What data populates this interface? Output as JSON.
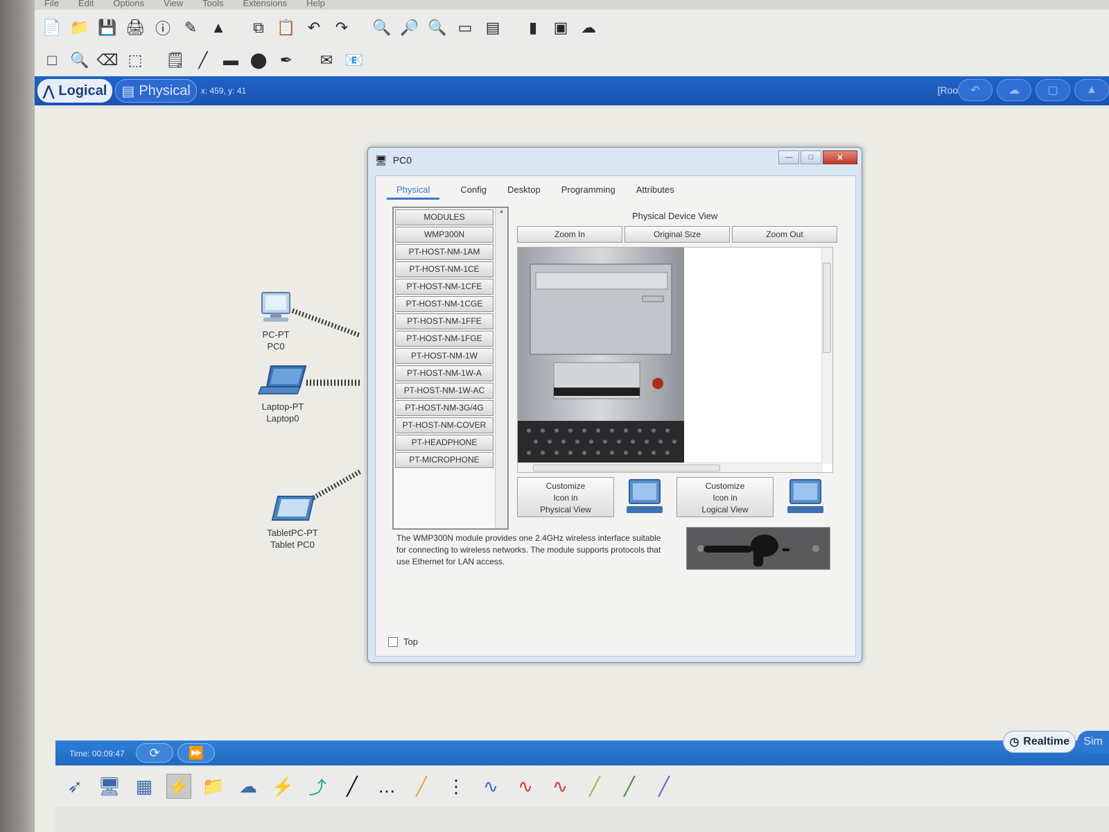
{
  "menu": [
    "File",
    "Edit",
    "Options",
    "View",
    "Tools",
    "Extensions",
    "Help"
  ],
  "modebar": {
    "logical_label": "Logical",
    "physical_label": "Physical",
    "coords": "x: 459, y: 41",
    "root_label": "[Root]"
  },
  "devices": [
    {
      "type": "PC-PT",
      "name": "PC0"
    },
    {
      "type": "Laptop-PT",
      "name": "Laptop0"
    },
    {
      "type": "TabletPC-PT",
      "name": "Tablet PC0"
    }
  ],
  "dialog": {
    "title": "PC0",
    "tabs": [
      "Physical",
      "Config",
      "Desktop",
      "Programming",
      "Attributes"
    ],
    "active_tab": "Physical",
    "modules_header": "MODULES",
    "modules": [
      "WMP300N",
      "PT-HOST-NM-1AM",
      "PT-HOST-NM-1CE",
      "PT-HOST-NM-1CFE",
      "PT-HOST-NM-1CGE",
      "PT-HOST-NM-1FFE",
      "PT-HOST-NM-1FGE",
      "PT-HOST-NM-1W",
      "PT-HOST-NM-1W-A",
      "PT-HOST-NM-1W-AC",
      "PT-HOST-NM-3G/4G",
      "PT-HOST-NM-COVER",
      "PT-HEADPHONE",
      "PT-MICROPHONE"
    ],
    "physical_device_view_label": "Physical Device View",
    "zoom_in": "Zoom In",
    "original_size": "Original Size",
    "zoom_out": "Zoom Out",
    "customize_physical": [
      "Customize",
      "Icon in",
      "Physical View"
    ],
    "customize_logical": [
      "Customize",
      "Icon in",
      "Logical View"
    ],
    "description": "The WMP300N module provides one 2.4GHz wireless interface suitable for connecting to wireless networks. The module supports protocols that use Ethernet for LAN access.",
    "top_checkbox": "Top"
  },
  "bottom": {
    "time_label": "Time: 00:09:47",
    "realtime_label": "Realtime",
    "sim_label": "Sim"
  }
}
